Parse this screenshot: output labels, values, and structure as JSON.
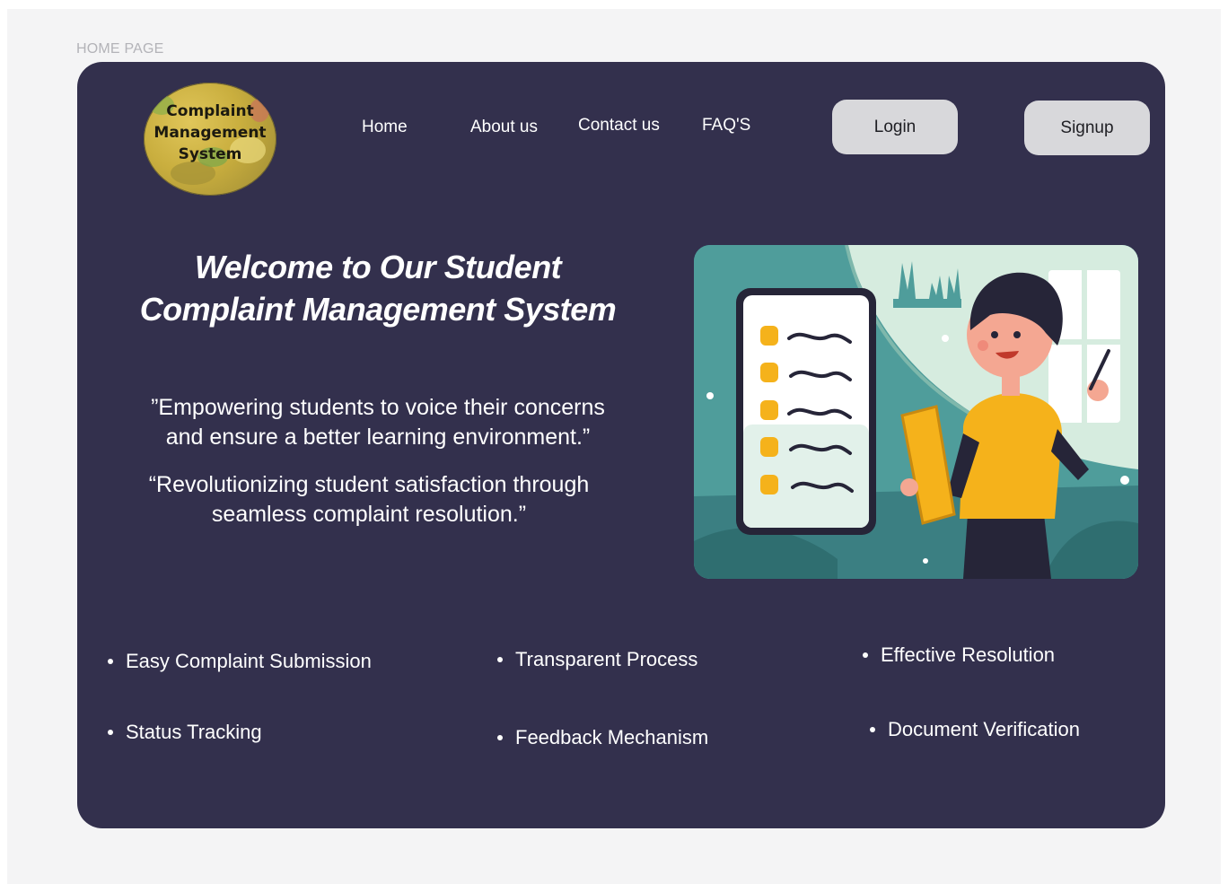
{
  "frame_label": "HOME PAGE",
  "logo": {
    "lines": [
      "Complaint",
      "Management",
      "System"
    ]
  },
  "nav": {
    "home": "Home",
    "about": "About us",
    "contact": "Contact us",
    "faq": "FAQ'S"
  },
  "auth": {
    "login": "Login",
    "signup": "Signup"
  },
  "hero": {
    "title_line1": "Welcome to Our Student",
    "title_line2": "Complaint Management System",
    "quote1_line1": "”Empowering students to voice their concerns",
    "quote1_line2": "and ensure a better learning environment.”",
    "quote2_line1": "“Revolutionizing student satisfaction through",
    "quote2_line2": "seamless complaint resolution.”"
  },
  "features": {
    "f1": "Easy Complaint Submission",
    "f2": "Transparent Process",
    "f3": "Effective Resolution",
    "f4": "Status Tracking",
    "f5": "Feedback Mechanism",
    "f6": "Document Verification"
  },
  "colors": {
    "frame_bg": "#33304d",
    "button_bg": "#d8d8db",
    "illustration_teal": "#4f9d9b",
    "accent_yellow": "#f5b21b"
  }
}
